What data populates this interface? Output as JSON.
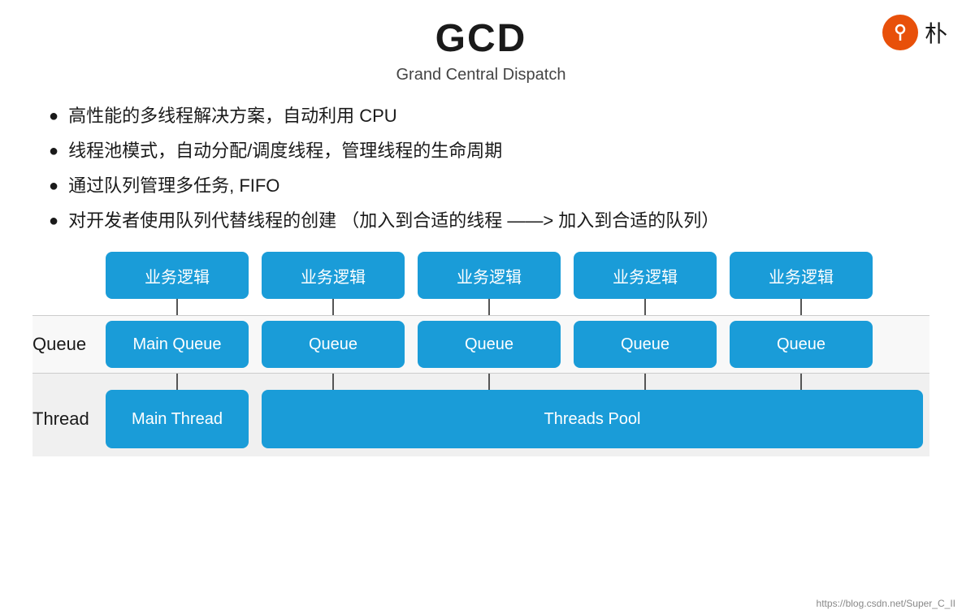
{
  "header": {
    "title": "GCD",
    "subtitle": "Grand Central Dispatch"
  },
  "bullets": [
    "高性能的多线程解决方案，自动利用 CPU",
    "线程池模式，自动分配/调度线程，管理线程的生命周期",
    "通过队列管理多任务, FIFO",
    "对开发者使用队列代替线程的创建 （加入到合适的线程 ——> 加入到合适的队列）"
  ],
  "diagram": {
    "business_row_label": "",
    "queue_row_label": "Queue",
    "thread_row_label": "Thread",
    "business_boxes": [
      "业务逻辑",
      "业务逻辑",
      "业务逻辑",
      "业务逻辑",
      "业务逻辑"
    ],
    "queue_boxes": [
      "Main Queue",
      "Queue",
      "Queue",
      "Queue",
      "Queue"
    ],
    "thread_main": "Main Thread",
    "thread_pool": "Threads Pool"
  },
  "logo": {
    "icon": "Q",
    "text": "朴"
  },
  "watermark": "https://blog.csdn.net/Super_C_II"
}
